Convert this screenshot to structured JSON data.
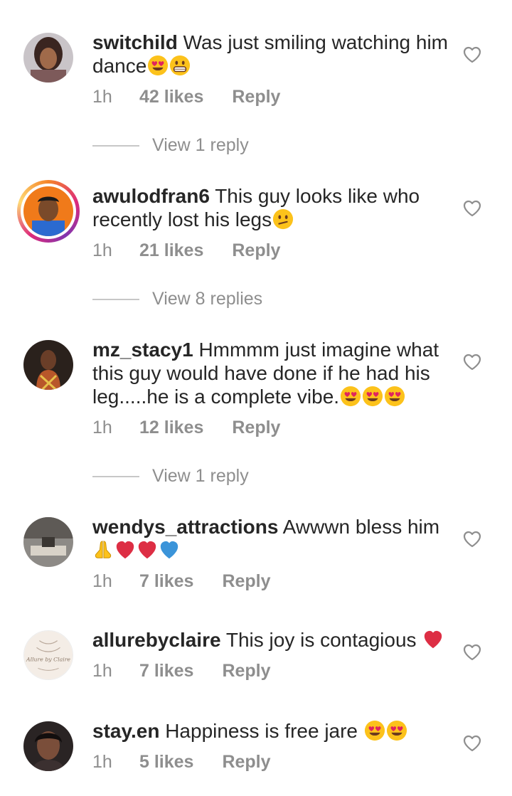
{
  "comments": [
    {
      "username": "switchild",
      "text": "Was just smiling watching him dance",
      "emojis": [
        "heart-eyes",
        "grin"
      ],
      "time": "1h",
      "likes": "42 likes",
      "reply": "Reply",
      "view_replies": "View 1 reply"
    },
    {
      "username": "awulodfran6",
      "text": "This guy looks like who recently lost his legs",
      "emojis": [
        "confused"
      ],
      "time": "1h",
      "likes": "21 likes",
      "reply": "Reply",
      "view_replies": "View 8 replies"
    },
    {
      "username": "mz_stacy1",
      "text": "Hmmmm just imagine what this guy would have done if he had his leg.....he is a complete vibe.",
      "emojis": [
        "heart-eyes",
        "heart-eyes",
        "heart-eyes"
      ],
      "time": "1h",
      "likes": "12 likes",
      "reply": "Reply",
      "view_replies": "View 1 reply"
    },
    {
      "username": "wendys_attractions",
      "text": "Awwwn bless him",
      "emojis": [
        "folded-hands",
        "red-heart",
        "red-heart",
        "blue-heart"
      ],
      "time": "1h",
      "likes": "7 likes",
      "reply": "Reply"
    },
    {
      "username": "allurebyclaire",
      "text": "This joy is contagious",
      "emojis": [
        "red-heart"
      ],
      "time": "1h",
      "likes": "7 likes",
      "reply": "Reply"
    },
    {
      "username": "stay.en",
      "text": "Happiness is free jare",
      "emojis": [
        "heart-eyes",
        "heart-eyes"
      ],
      "time": "1h",
      "likes": "5 likes",
      "reply": "Reply"
    }
  ],
  "avatar_logo_text": "Allure by Claire",
  "colors": {
    "text": "#262626",
    "meta": "#8e8e8e",
    "divider": "#c7c7c7",
    "heart_red": "#e0245e",
    "heart_blue": "#3b94d9",
    "emoji_yellow": "#fcc21b"
  }
}
